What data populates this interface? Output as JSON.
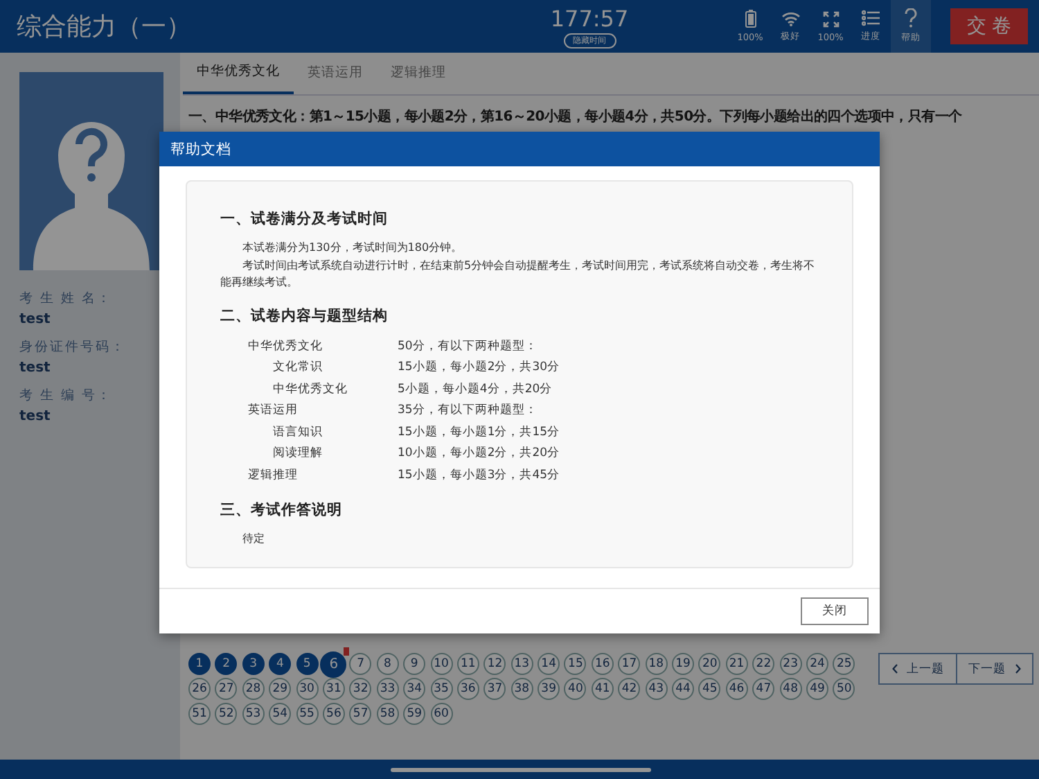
{
  "header": {
    "title": "综合能力（一）",
    "timer": "177:57",
    "hide_time_button": "隐藏时间",
    "tools": [
      {
        "kind": "battery",
        "label": "100%",
        "selected": false
      },
      {
        "kind": "wifi",
        "label": "极好",
        "selected": false
      },
      {
        "kind": "fullscreen",
        "label": "100%",
        "selected": false
      },
      {
        "kind": "progress",
        "label": "进度",
        "selected": false
      },
      {
        "kind": "help",
        "label": "帮助",
        "selected": true
      }
    ],
    "submit_button": "交 卷"
  },
  "candidate": {
    "fields": [
      {
        "label": "考 生 姓 名：",
        "value": "test"
      },
      {
        "label": "身份证件号码：",
        "value": "test"
      },
      {
        "label": "考 生 编 号：",
        "value": "test"
      }
    ]
  },
  "tabs": [
    {
      "label": "中华优秀文化",
      "selected": true
    },
    {
      "label": "英语运用",
      "selected": false
    },
    {
      "label": "逻辑推理",
      "selected": false
    }
  ],
  "question_text": "一、中华优秀文化：第1～15小题，每小题2分，第16～20小题，每小题4分，共50分。下列每小题给出的四个选项中，只有一个",
  "questions": [
    {
      "number": "1",
      "answered": true,
      "selected": false,
      "flagged": false
    },
    {
      "number": "2",
      "answered": true,
      "selected": false,
      "flagged": false
    },
    {
      "number": "3",
      "answered": true,
      "selected": false,
      "flagged": false
    },
    {
      "number": "4",
      "answered": true,
      "selected": false,
      "flagged": false
    },
    {
      "number": "5",
      "answered": true,
      "selected": false,
      "flagged": false
    },
    {
      "number": "6",
      "answered": true,
      "selected": true,
      "flagged": true
    },
    {
      "number": "7",
      "answered": false,
      "selected": false,
      "flagged": false
    },
    {
      "number": "8",
      "answered": false,
      "selected": false,
      "flagged": false
    },
    {
      "number": "9",
      "answered": false,
      "selected": false,
      "flagged": false
    },
    {
      "number": "10",
      "answered": false,
      "selected": false,
      "flagged": false
    },
    {
      "number": "11",
      "answered": false,
      "selected": false,
      "flagged": false
    },
    {
      "number": "12",
      "answered": false,
      "selected": false,
      "flagged": false
    },
    {
      "number": "13",
      "answered": false,
      "selected": false,
      "flagged": false
    },
    {
      "number": "14",
      "answered": false,
      "selected": false,
      "flagged": false
    },
    {
      "number": "15",
      "answered": false,
      "selected": false,
      "flagged": false
    },
    {
      "number": "16",
      "answered": false,
      "selected": false,
      "flagged": false
    },
    {
      "number": "17",
      "answered": false,
      "selected": false,
      "flagged": false
    },
    {
      "number": "18",
      "answered": false,
      "selected": false,
      "flagged": false
    },
    {
      "number": "19",
      "answered": false,
      "selected": false,
      "flagged": false
    },
    {
      "number": "20",
      "answered": false,
      "selected": false,
      "flagged": false
    },
    {
      "number": "21",
      "answered": false,
      "selected": false,
      "flagged": false
    },
    {
      "number": "22",
      "answered": false,
      "selected": false,
      "flagged": false
    },
    {
      "number": "23",
      "answered": false,
      "selected": false,
      "flagged": false
    },
    {
      "number": "24",
      "answered": false,
      "selected": false,
      "flagged": false
    },
    {
      "number": "25",
      "answered": false,
      "selected": false,
      "flagged": false
    },
    {
      "number": "26",
      "answered": false,
      "selected": false,
      "flagged": false
    },
    {
      "number": "27",
      "answered": false,
      "selected": false,
      "flagged": false
    },
    {
      "number": "28",
      "answered": false,
      "selected": false,
      "flagged": false
    },
    {
      "number": "29",
      "answered": false,
      "selected": false,
      "flagged": false
    },
    {
      "number": "30",
      "answered": false,
      "selected": false,
      "flagged": false
    },
    {
      "number": "31",
      "answered": false,
      "selected": false,
      "flagged": false
    },
    {
      "number": "32",
      "answered": false,
      "selected": false,
      "flagged": false
    },
    {
      "number": "33",
      "answered": false,
      "selected": false,
      "flagged": false
    },
    {
      "number": "34",
      "answered": false,
      "selected": false,
      "flagged": false
    },
    {
      "number": "35",
      "answered": false,
      "selected": false,
      "flagged": false
    },
    {
      "number": "36",
      "answered": false,
      "selected": false,
      "flagged": false
    },
    {
      "number": "37",
      "answered": false,
      "selected": false,
      "flagged": false
    },
    {
      "number": "38",
      "answered": false,
      "selected": false,
      "flagged": false
    },
    {
      "number": "39",
      "answered": false,
      "selected": false,
      "flagged": false
    },
    {
      "number": "40",
      "answered": false,
      "selected": false,
      "flagged": false
    },
    {
      "number": "41",
      "answered": false,
      "selected": false,
      "flagged": false
    },
    {
      "number": "42",
      "answered": false,
      "selected": false,
      "flagged": false
    },
    {
      "number": "43",
      "answered": false,
      "selected": false,
      "flagged": false
    },
    {
      "number": "44",
      "answered": false,
      "selected": false,
      "flagged": false
    },
    {
      "number": "45",
      "answered": false,
      "selected": false,
      "flagged": false
    },
    {
      "number": "46",
      "answered": false,
      "selected": false,
      "flagged": false
    },
    {
      "number": "47",
      "answered": false,
      "selected": false,
      "flagged": false
    },
    {
      "number": "48",
      "answered": false,
      "selected": false,
      "flagged": false
    },
    {
      "number": "49",
      "answered": false,
      "selected": false,
      "flagged": false
    },
    {
      "number": "50",
      "answered": false,
      "selected": false,
      "flagged": false
    },
    {
      "number": "51",
      "answered": false,
      "selected": false,
      "flagged": false
    },
    {
      "number": "52",
      "answered": false,
      "selected": false,
      "flagged": false
    },
    {
      "number": "53",
      "answered": false,
      "selected": false,
      "flagged": false
    },
    {
      "number": "54",
      "answered": false,
      "selected": false,
      "flagged": false
    },
    {
      "number": "55",
      "answered": false,
      "selected": false,
      "flagged": false
    },
    {
      "number": "56",
      "answered": false,
      "selected": false,
      "flagged": false
    },
    {
      "number": "57",
      "answered": false,
      "selected": false,
      "flagged": false
    },
    {
      "number": "58",
      "answered": false,
      "selected": false,
      "flagged": false
    },
    {
      "number": "59",
      "answered": false,
      "selected": false,
      "flagged": false
    },
    {
      "number": "60",
      "answered": false,
      "selected": false,
      "flagged": false
    }
  ],
  "nav": {
    "prev": "上一题",
    "next": "下一题"
  },
  "dialog": {
    "title": "帮助文档",
    "close_button": "关闭",
    "sections": [
      {
        "heading": "一、试卷满分及考试时间",
        "paragraphs": [
          "本试卷满分为130分，考试时间为180分钟。",
          "考试时间由考试系统自动进行计时，在结束前5分钟会自动提醒考生，考试时间用完，考试系统将自动交卷，考生将不能再继续考试。"
        ]
      },
      {
        "heading": "二、试卷内容与题型结构",
        "rows": [
          {
            "label": "中华优秀文化",
            "value": "50分，有以下两种题型：",
            "children": [
              {
                "label": "文化常识",
                "value": "15小题，每小题2分，共30分"
              },
              {
                "label": "中华优秀文化",
                "value": "5小题，每小题4分，共20分"
              }
            ]
          },
          {
            "label": "英语运用",
            "value": "35分，有以下两种题型：",
            "children": [
              {
                "label": "语言知识",
                "value": "15小题，每小题1分，共15分"
              },
              {
                "label": "阅读理解",
                "value": "10小题，每小题2分，共20分"
              }
            ]
          },
          {
            "label": "逻辑推理",
            "value": "15小题，每小题3分，共45分"
          }
        ]
      },
      {
        "heading": "三、考试作答说明",
        "paragraphs": [
          "待定"
        ]
      }
    ]
  }
}
